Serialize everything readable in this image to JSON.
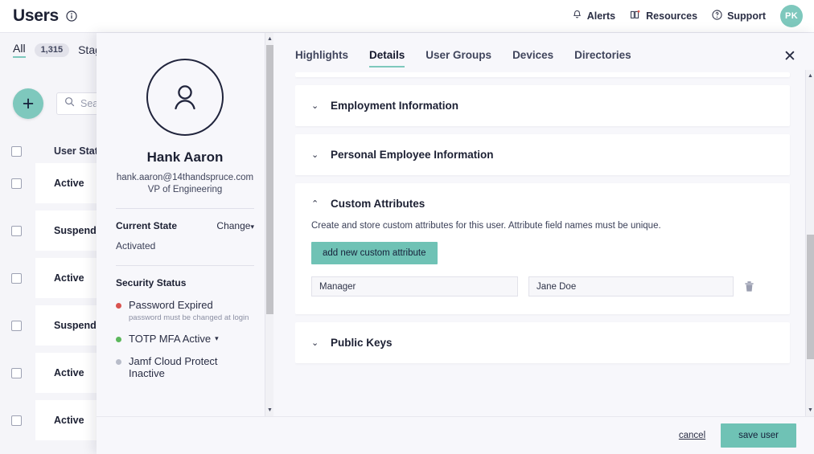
{
  "topbar": {
    "title": "Users",
    "info_icon": "info-circle-icon",
    "links": [
      {
        "label": "Alerts",
        "icon": "bell-icon"
      },
      {
        "label": "Resources",
        "icon": "book-icon"
      },
      {
        "label": "Support",
        "icon": "question-circle-icon"
      }
    ],
    "avatar_initials": "PK"
  },
  "background_page": {
    "filter_tabs": [
      {
        "label": "All",
        "count": "1,315",
        "active": true
      },
      {
        "label": "Stag",
        "count": "",
        "active": false
      }
    ],
    "add_button_label": "+",
    "search": {
      "placeholder": "Sear",
      "value": ""
    },
    "table": {
      "columns": [
        "User State"
      ],
      "rows": [
        {
          "state": "Active"
        },
        {
          "state": "Suspended"
        },
        {
          "state": "Active"
        },
        {
          "state": "Suspended"
        },
        {
          "state": "Active"
        },
        {
          "state": "Active"
        }
      ]
    }
  },
  "modal": {
    "close_label": "✕",
    "profile": {
      "name": "Hank Aaron",
      "email": "hank.aaron@14thandspruce.com",
      "role": "VP of Engineering",
      "current_state_title": "Current State",
      "change_label": "Change",
      "change_caret": "▾",
      "current_state_value": "Activated",
      "security_status_title": "Security Status",
      "statuses": [
        {
          "label": "Password Expired",
          "sub": "password must be changed at login",
          "color": "#d9534f",
          "caret": ""
        },
        {
          "label": "TOTP MFA Active",
          "sub": "",
          "color": "#5cb85c",
          "caret": "▾"
        },
        {
          "label": "Jamf Cloud Protect Inactive",
          "sub": "",
          "color": "#b8bcc9",
          "caret": ""
        }
      ]
    },
    "tabs": [
      {
        "label": "Highlights",
        "active": false
      },
      {
        "label": "Details",
        "active": true
      },
      {
        "label": "User Groups",
        "active": false
      },
      {
        "label": "Devices",
        "active": false
      },
      {
        "label": "Directories",
        "active": false
      }
    ],
    "sections": [
      {
        "title": "Employment Information",
        "expanded": false,
        "chevron": "⌄"
      },
      {
        "title": "Personal Employee Information",
        "expanded": false,
        "chevron": "⌄"
      },
      {
        "title": "Custom Attributes",
        "expanded": true,
        "chevron": "⌃"
      },
      {
        "title": "Public Keys",
        "expanded": false,
        "chevron": "⌄"
      }
    ],
    "custom_attributes": {
      "description": "Create and store custom attributes for this user. Attribute field names must be unique.",
      "add_button_label": "add new custom attribute",
      "rows": [
        {
          "key": "Manager",
          "value": "Jane Doe",
          "delete_icon": "trash-icon"
        }
      ]
    },
    "footer": {
      "cancel_label": "cancel",
      "save_label": "save user"
    }
  },
  "colors": {
    "accent_teal": "#6fc2b5",
    "avatar_teal": "#7ec8bd",
    "dark_navy": "#1c2033",
    "page_bg": "#f5f5f9",
    "status_red": "#d9534f",
    "status_green": "#5cb85c"
  }
}
